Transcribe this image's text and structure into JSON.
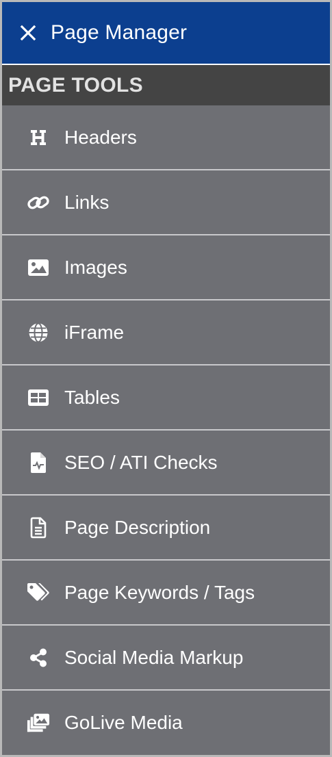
{
  "header": {
    "close_icon": "close-icon",
    "title": "Page Manager"
  },
  "section": {
    "title": "PAGE TOOLS"
  },
  "colors": {
    "header_bg": "#0c3f8f",
    "section_bg": "#444444",
    "item_bg": "#6e6f74",
    "divider": "#c9c9cc",
    "text": "#ffffff"
  },
  "menu": {
    "items": [
      {
        "label": "Headers",
        "icon": "header-icon"
      },
      {
        "label": "Links",
        "icon": "link-icon"
      },
      {
        "label": "Images",
        "icon": "image-icon"
      },
      {
        "label": "iFrame",
        "icon": "globe-icon"
      },
      {
        "label": "Tables",
        "icon": "table-icon"
      },
      {
        "label": "SEO / ATI Checks",
        "icon": "file-check-icon"
      },
      {
        "label": "Page Description",
        "icon": "document-icon"
      },
      {
        "label": "Page Keywords / Tags",
        "icon": "tags-icon"
      },
      {
        "label": "Social Media Markup",
        "icon": "share-icon"
      },
      {
        "label": "GoLive Media",
        "icon": "media-icon"
      }
    ]
  }
}
